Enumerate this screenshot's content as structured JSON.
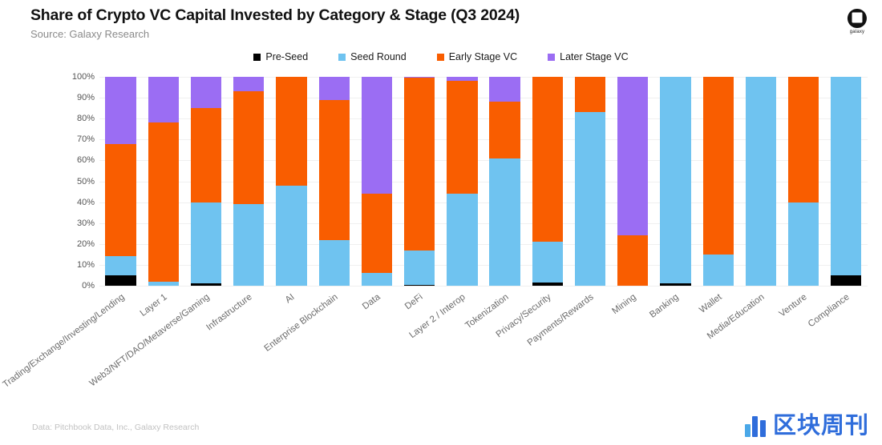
{
  "header": {
    "title": "Share of Crypto VC Capital Invested by Category & Stage (Q3 2024)",
    "subtitle": "Source: Galaxy Research",
    "logo_word": "galaxy",
    "logo_icon": "galaxy-logo-icon"
  },
  "footer": {
    "note": "Data: Pitchbook Data, Inc., Galaxy Research",
    "watermark_text": "区块周刊",
    "watermark_icon": "blockchain-weekly-logo-icon",
    "watermark_color": "#2f6ddb"
  },
  "colors": {
    "pre_seed": "#000000",
    "seed_round": "#6FC3F0",
    "early_stage": "#F95D00",
    "later_stage": "#9B6DF3",
    "grid": "#f0f0f0",
    "axis_text": "#555555",
    "label_text": "#6b6b6b"
  },
  "chart_data": {
    "type": "bar",
    "stacked": true,
    "stack_mode": "percent",
    "title": "Share of Crypto VC Capital Invested by Category & Stage (Q3 2024)",
    "subtitle": "Source: Galaxy Research",
    "xlabel": "",
    "ylabel": "",
    "ylim": [
      0,
      100
    ],
    "yticks": [
      "0%",
      "10%",
      "20%",
      "30%",
      "40%",
      "50%",
      "60%",
      "70%",
      "80%",
      "90%",
      "100%"
    ],
    "ytick_values": [
      0,
      10,
      20,
      30,
      40,
      50,
      60,
      70,
      80,
      90,
      100
    ],
    "grid": true,
    "legend_position": "top-center",
    "categories": [
      "Trading/Exchange/Investing/Lending",
      "Layer 1",
      "Web3/NFT/DAO/Metaverse/Gaming",
      "Infrastructure",
      "AI",
      "Enterprise Blockchain",
      "Data",
      "DeFi",
      "Layer 2 / Interop",
      "Tokenization",
      "Privacy/Security",
      "Payments/Rewards",
      "Mining",
      "Banking",
      "Wallet",
      "Media/Education",
      "Venture",
      "Compliance"
    ],
    "series": [
      {
        "name": "Pre-Seed",
        "color": "#000000",
        "values": [
          5.0,
          0.0,
          1.2,
          0.0,
          0.0,
          0.0,
          0.0,
          0.5,
          0.0,
          0.0,
          1.5,
          0.0,
          0.0,
          1.0,
          0.0,
          0.0,
          0.0,
          5.0
        ]
      },
      {
        "name": "Seed Round",
        "color": "#6FC3F0",
        "values": [
          9.0,
          2.0,
          38.8,
          39.0,
          48.0,
          22.0,
          6.0,
          16.5,
          44.0,
          61.0,
          19.5,
          83.0,
          0.0,
          99.0,
          15.0,
          100.0,
          40.0,
          95.0
        ]
      },
      {
        "name": "Early Stage VC",
        "color": "#F95D00",
        "values": [
          54.0,
          76.0,
          45.0,
          54.0,
          52.0,
          67.0,
          38.0,
          82.5,
          54.0,
          27.0,
          79.0,
          17.0,
          24.0,
          0.0,
          85.0,
          0.0,
          60.0,
          0.0
        ]
      },
      {
        "name": "Later Stage VC",
        "color": "#9B6DF3",
        "values": [
          32.0,
          22.0,
          15.0,
          7.0,
          0.0,
          11.0,
          56.0,
          0.5,
          2.0,
          12.0,
          0.0,
          0.0,
          76.0,
          0.0,
          0.0,
          0.0,
          0.0,
          0.0
        ]
      }
    ]
  }
}
